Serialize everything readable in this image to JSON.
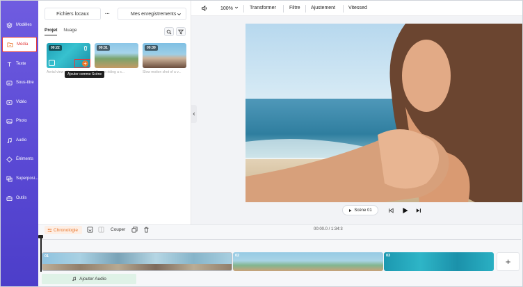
{
  "sidebar": {
    "items": [
      {
        "label": "Modèles",
        "icon": "layers-icon"
      },
      {
        "label": "Média",
        "icon": "folder-icon",
        "active": true
      },
      {
        "label": "Texte",
        "icon": "text-icon"
      },
      {
        "label": "Sous-titre",
        "icon": "subtitle-icon"
      },
      {
        "label": "Vidéo",
        "icon": "video-icon"
      },
      {
        "label": "Photo",
        "icon": "image-icon"
      },
      {
        "label": "Audio",
        "icon": "music-icon"
      },
      {
        "label": "Éléments",
        "icon": "shapes-icon"
      },
      {
        "label": "Superposi...",
        "icon": "overlay-icon"
      },
      {
        "label": "Outils",
        "icon": "toolbox-icon"
      }
    ]
  },
  "media": {
    "local_files_label": "Fichiers locaux",
    "more_label": "···",
    "recordings_label": "Mes enregistrements",
    "tabs": [
      "Projet",
      "Nuage"
    ],
    "thumbnails": [
      {
        "duration": "00:22",
        "caption": "Aerial view of t..."
      },
      {
        "duration": "00:31",
        "caption": "Woman riding a s..."
      },
      {
        "duration": "00:39",
        "caption": "Slow motion shot of a v..."
      }
    ],
    "tooltip": "Ajouter comme Scène"
  },
  "toolbar": {
    "zoom": "100%",
    "items": [
      "Transformer",
      "Filtre",
      "Ajustement",
      "Vitessed"
    ]
  },
  "player": {
    "scene_label": "Scène 01"
  },
  "timeline": {
    "chronologie_label": "Chronologie",
    "couper_label": "Couper",
    "time": "00:00.0 / 1:34:3",
    "clips": [
      "01",
      "02",
      "03"
    ],
    "add_audio_label": "Ajouter Audio",
    "add_scene_label": "+"
  },
  "colors": {
    "sidebar": "#5a49d4",
    "active_highlight": "#e23b3b",
    "accent_orange": "#e8772e",
    "audio_track": "#dff2e7"
  }
}
